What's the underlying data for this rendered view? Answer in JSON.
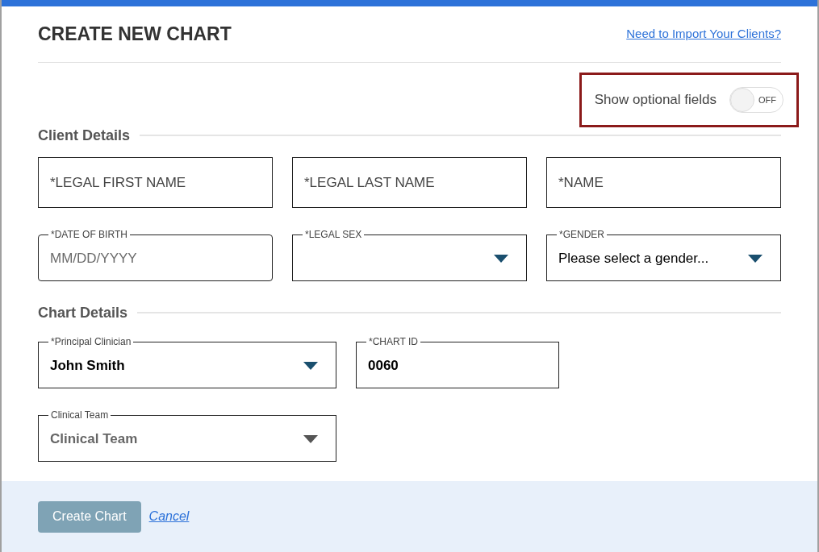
{
  "header": {
    "title": "CREATE NEW CHART",
    "import_link": "Need to Import Your Clients?"
  },
  "optional_toggle": {
    "label": "Show optional fields",
    "state_label": "OFF",
    "on": false,
    "highlighted": true
  },
  "sections": [
    {
      "title": "Client Details",
      "rows": [
        [
          {
            "kind": "text",
            "placeholder": "*LEGAL FIRST NAME"
          },
          {
            "kind": "text",
            "placeholder": "*LEGAL LAST NAME"
          },
          {
            "kind": "text",
            "placeholder": "*NAME"
          }
        ],
        [
          {
            "kind": "date",
            "label": "*DATE OF BIRTH",
            "placeholder": "MM/DD/YYYY"
          },
          {
            "kind": "select",
            "label": "*LEGAL SEX"
          },
          {
            "kind": "select",
            "label": "*GENDER",
            "value": "Please select a gender..."
          }
        ]
      ]
    },
    {
      "title": "Chart Details",
      "rows": [
        [
          {
            "kind": "select",
            "label": "*Principal Clinician",
            "value": "John Smith",
            "bold": true
          },
          {
            "kind": "text",
            "label": "*CHART ID",
            "value": "0060",
            "bold": true
          }
        ],
        [
          {
            "kind": "select",
            "label": "Clinical Team",
            "placeholder": "Clinical Team"
          }
        ]
      ]
    }
  ],
  "footer": {
    "submit": {
      "label": "Create Chart",
      "disabled": true
    },
    "cancel": "Cancel"
  }
}
